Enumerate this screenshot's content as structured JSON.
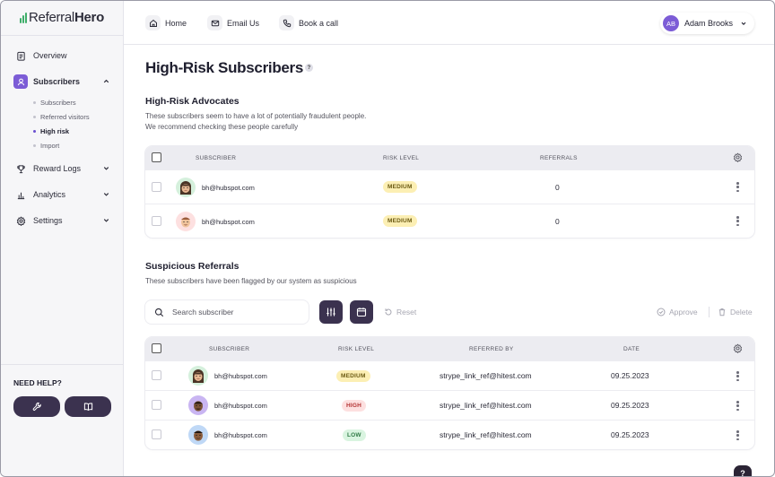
{
  "app": {
    "logo_text_light": "Referral",
    "logo_text_bold": "Hero"
  },
  "sidebar": {
    "items": [
      {
        "label": "Overview",
        "icon": "clipboard-icon"
      },
      {
        "label": "Subscribers",
        "icon": "user-icon"
      },
      {
        "label": "Reward Logs",
        "icon": "trophy-icon"
      },
      {
        "label": "Analytics",
        "icon": "bar-chart-icon"
      },
      {
        "label": "Settings",
        "icon": "gear-icon"
      }
    ],
    "subitems": [
      "Subscribers",
      "Referred visitors",
      "High risk",
      "Import"
    ],
    "active_subitem": "High risk",
    "help_title": "NEED HELP?",
    "help_buttons": [
      "wrench-icon",
      "book-icon"
    ]
  },
  "topbar": {
    "links": [
      {
        "label": "Home",
        "icon": "home-icon"
      },
      {
        "label": "Email Us",
        "icon": "mail-icon"
      },
      {
        "label": "Book a call",
        "icon": "phone-icon"
      }
    ],
    "user": {
      "initials": "AB",
      "name": "Adam Brooks"
    }
  },
  "page": {
    "title": "High-Risk Subscribers",
    "help_glyph": "?"
  },
  "advocates": {
    "title": "High-Risk Advocates",
    "desc_line1": "These subscribers seem to have a lot of potentially fraudulent people.",
    "desc_line2": "We recommend checking these people carefully",
    "columns": [
      "SUBSCRIBER",
      "RISK LEVEL",
      "REFERRALS"
    ],
    "rows": [
      {
        "email": "bh@hubspot.com",
        "risk": "MEDIUM",
        "referrals": "0"
      },
      {
        "email": "bh@hubspot.com",
        "risk": "MEDIUM",
        "referrals": "0"
      }
    ]
  },
  "suspicious": {
    "title": "Suspicious Referrals",
    "desc": "These subscribers have been flagged by our system as suspicious",
    "search_placeholder": "Search subscriber",
    "reset_label": "Reset",
    "approve_label": "Approve",
    "delete_label": "Delete",
    "columns": [
      "SUBSCRIBER",
      "RISK LEVEL",
      "REFERRED BY",
      "DATE"
    ],
    "rows": [
      {
        "email": "bh@hubspot.com",
        "risk": "MEDIUM",
        "referred_by": "strype_link_ref@hitest.com",
        "date": "09.25.2023"
      },
      {
        "email": "bh@hubspot.com",
        "risk": "HIGH",
        "referred_by": "strype_link_ref@hitest.com",
        "date": "09.25.2023"
      },
      {
        "email": "bh@hubspot.com",
        "risk": "LOW",
        "referred_by": "strype_link_ref@hitest.com",
        "date": "09.25.2023"
      }
    ]
  },
  "colors": {
    "accent": "#7c5cd6",
    "dark_button": "#3b324f",
    "medium": "#fcefb4",
    "high": "#fde0e0",
    "low": "#d9f4e0"
  },
  "fab": {
    "label": "?"
  }
}
